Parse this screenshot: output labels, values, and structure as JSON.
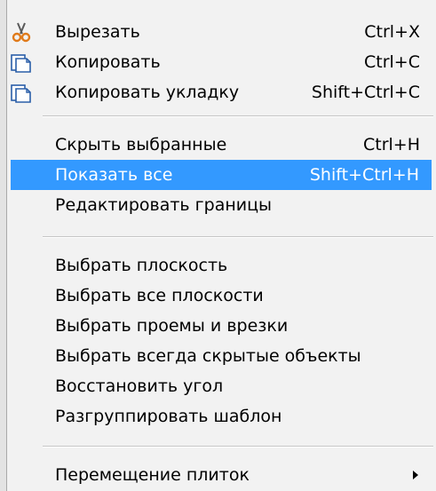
{
  "menu": {
    "items": [
      {
        "label": "Вырезать",
        "shortcut": "Ctrl+X",
        "icon": "scissors-icon"
      },
      {
        "label": "Копировать",
        "shortcut": "Ctrl+C",
        "icon": "copy-icon"
      },
      {
        "label": "Копировать укладку",
        "shortcut": "Shift+Ctrl+C",
        "icon": "copy-icon"
      },
      {
        "label": "Скрыть выбранные",
        "shortcut": "Ctrl+H"
      },
      {
        "label": "Показать все",
        "shortcut": "Shift+Ctrl+H",
        "highlighted": true
      },
      {
        "label": "Редактировать границы"
      },
      {
        "label": "Выбрать плоскость"
      },
      {
        "label": "Выбрать все плоскости"
      },
      {
        "label": "Выбрать проемы и врезки"
      },
      {
        "label": "Выбрать всегда скрытые объекты"
      },
      {
        "label": "Восстановить угол"
      },
      {
        "label": "Разгруппировать шаблон"
      },
      {
        "label": "Перемещение плиток",
        "submenu": true
      }
    ]
  },
  "colors": {
    "menu_background": "#f2f2f2",
    "highlight": "#3399ff",
    "highlight_text": "#ffffff",
    "separator": "#c6c6c6"
  }
}
